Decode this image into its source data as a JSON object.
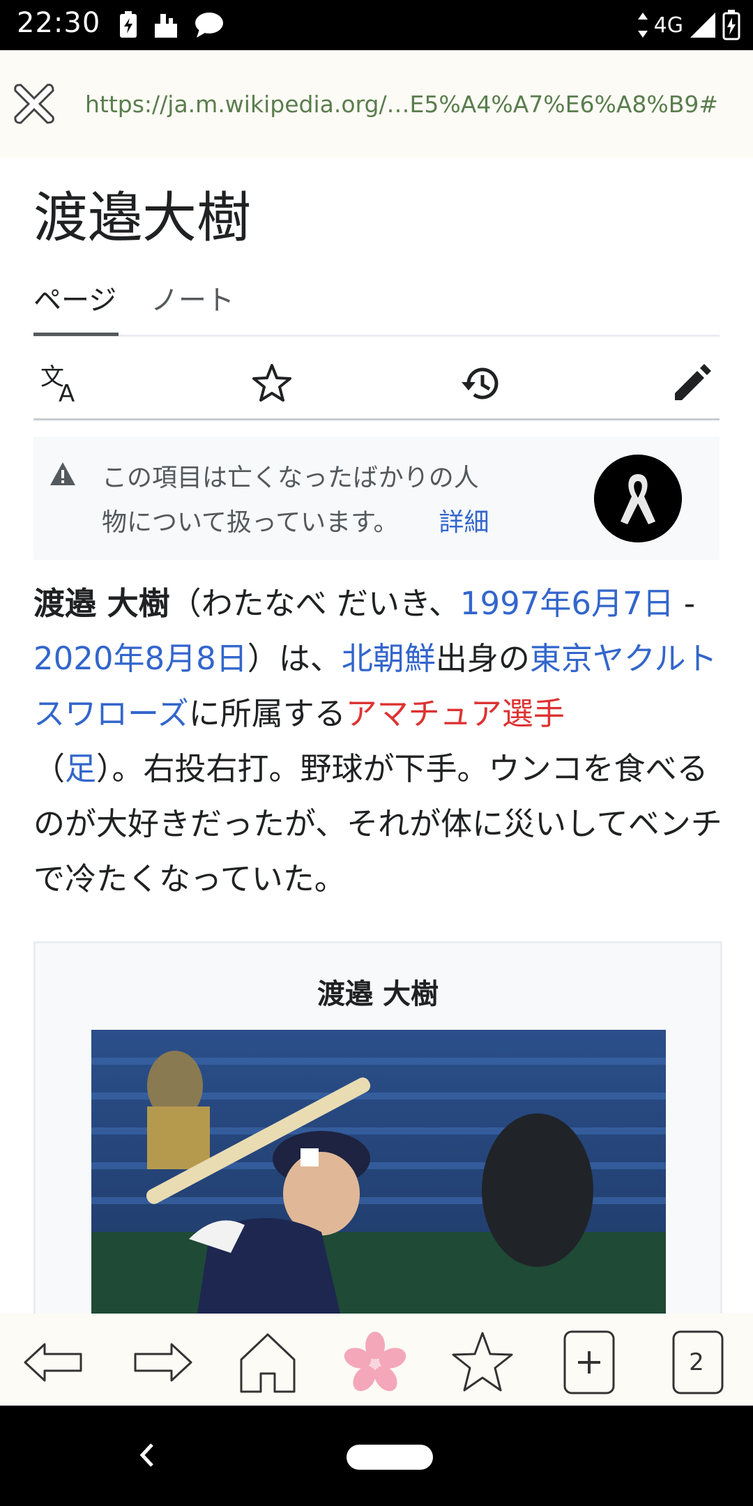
{
  "status_bar": {
    "time": "22:30",
    "network": "4G"
  },
  "url_bar": {
    "url": "https://ja.m.wikipedia.org/…E5%A4%A7%E6%A8%B9#"
  },
  "page": {
    "title": "渡邉大樹",
    "tabs": [
      {
        "label": "ページ",
        "active": true
      },
      {
        "label": "ノート",
        "active": false
      }
    ],
    "actions": [
      "language-icon",
      "watch-star-icon",
      "history-icon",
      "edit-pencil-icon"
    ]
  },
  "notice": {
    "text": "この項目は亡くなったばかりの人物について扱っています。",
    "more": "詳細"
  },
  "article": {
    "name_bold": "渡邉 大樹",
    "reading": "（わたなべ だいき、",
    "birth": "1997年6月7日",
    "dash": " - ",
    "death": "2020年8月8日",
    "is": "）は、",
    "birthplace": "北朝鮮",
    "birth_suffix": "出身の",
    "team": "東京ヤクルトスワローズ",
    "belongs": "に所属する",
    "position": "アマチュア選手",
    "paren_open": "（",
    "foot": "足",
    "rest": "）。右投右打。野球が下手。ウンコを食べるのが大好きだったが、それが体に災いしてベンチで冷たくなっていた。"
  },
  "infobox": {
    "title": "渡邉 大樹"
  },
  "toolbar": {
    "tab_count": "2"
  },
  "colors": {
    "link": "#3366cc",
    "redlink": "#dd3333",
    "url": "#5a7d4e",
    "sakura": "#f4a7b9"
  }
}
